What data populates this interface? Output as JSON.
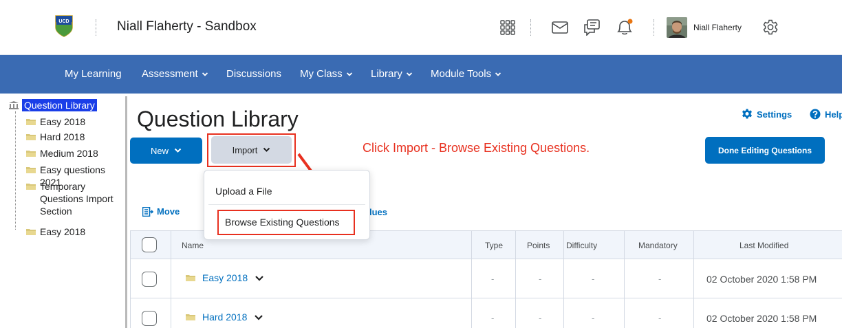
{
  "header": {
    "org_title": "Niall Flaherty - Sandbox",
    "logo_text": "UCD",
    "user_name": "Niall Flaherty"
  },
  "nav": {
    "items": [
      {
        "label": "My Learning",
        "dropdown": false
      },
      {
        "label": "Assessment",
        "dropdown": true
      },
      {
        "label": "Discussions",
        "dropdown": false
      },
      {
        "label": "My Class",
        "dropdown": true
      },
      {
        "label": "Library",
        "dropdown": true
      },
      {
        "label": "Module Tools",
        "dropdown": true
      }
    ]
  },
  "tree": {
    "root": "Question Library",
    "items": [
      "Easy 2018",
      "Hard 2018",
      "Medium 2018",
      "Easy questions 2021",
      "Temporary Questions Import Section",
      "Easy 2018"
    ]
  },
  "main": {
    "title": "Question Library",
    "settings_label": "Settings",
    "help_label": "Help",
    "new_label": "New",
    "import_label": "Import",
    "done_label": "Done Editing Questions",
    "annotation": "Click Import - Browse Existing Questions.",
    "move_label": "Move",
    "values_partial": "lues"
  },
  "import_menu": {
    "items": [
      "Upload a File",
      "Browse Existing Questions"
    ]
  },
  "table": {
    "headers": {
      "name": "Name",
      "type": "Type",
      "points": "Points",
      "difficulty": "Difficulty",
      "mandatory": "Mandatory",
      "modified": "Last Modified"
    },
    "rows": [
      {
        "name": "Easy 2018",
        "type": "-",
        "points": "-",
        "difficulty": "-",
        "mandatory": "-",
        "modified": "02 October 2020 1:58 PM"
      },
      {
        "name": "Hard 2018",
        "type": "-",
        "points": "-",
        "difficulty": "-",
        "mandatory": "-",
        "modified": "02 October 2020 1:58 PM"
      }
    ]
  },
  "colors": {
    "nav_bg": "#3a6bb3",
    "primary": "#006fbf",
    "annotation_red": "#e8301f",
    "tree_highlight": "#1a3ee8"
  }
}
